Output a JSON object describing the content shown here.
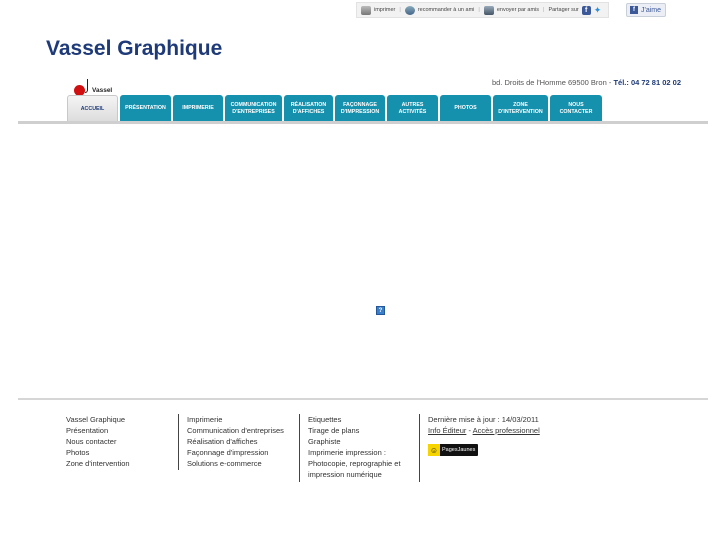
{
  "toolbar": {
    "print": "imprimer",
    "recommend": "recommander à un ami",
    "send": "envoyer par amis",
    "share": "Partager sur",
    "like": "J'aime"
  },
  "site": {
    "title": "Vassel Graphique",
    "logo_text": "Vassel"
  },
  "header": {
    "address": "bd. Droits de l'Homme 69500 Bron  - ",
    "tel": "Tél.: 04 72 81 02 02"
  },
  "nav": [
    "ACCUEIL",
    "PRÉSENTATION",
    "IMPRIMERIE",
    "COMMUNICATION D'ENTREPRISES",
    "RÉALISATION D'AFFICHES",
    "FAÇONNAGE D'IMPRESSION",
    "AUTRES ACTIVITÉS",
    "PHOTOS",
    "ZONE D'INTERVENTION",
    "NOUS CONTACTER"
  ],
  "main": {
    "placeholder_glyph": "?"
  },
  "footer": {
    "col1": [
      "Vassel Graphique",
      "Présentation",
      "Nous contacter",
      "Photos",
      "Zone d'intervention"
    ],
    "col2": [
      "Imprimerie",
      "Communication d'entreprises",
      "Réalisation d'affiches",
      "Façonnage d'impression",
      "Solutions e-commerce"
    ],
    "col3": [
      "Etiquettes",
      "Tirage de plans",
      "Graphiste",
      "Imprimerie impression :",
      "Photocopie, reprographie et",
      "impression numérique"
    ],
    "updated": "Dernière mise à jour : 14/03/2011",
    "info_editor": "Info Éditeur",
    "dash": " - ",
    "pro_access": "Accès professionnel",
    "pj_logo": "PagesJaunes"
  }
}
